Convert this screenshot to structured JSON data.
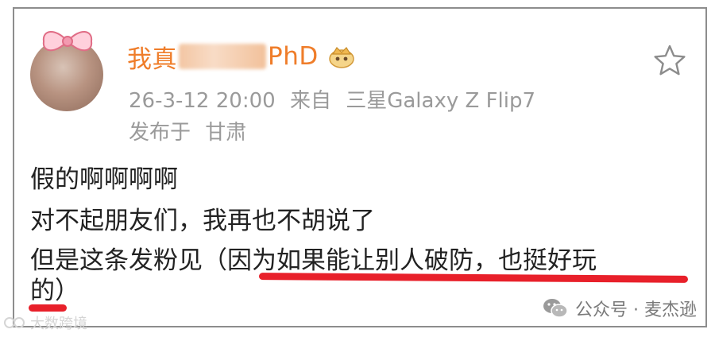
{
  "post": {
    "username_prefix": "我真",
    "username_suffix": "PhD",
    "timestamp": "26-3-12 20:00",
    "source_label": "来自",
    "device": "三星Galaxy Z Flip7",
    "location_label": "发布于",
    "location": "甘肃",
    "content_lines": [
      "假的啊啊啊啊",
      "对不起朋友们，我再也不胡说了",
      "但是这条发粉见（因为如果能让别人破防，也挺好玩",
      "的）"
    ]
  },
  "icons": {
    "badge": "crown-badge-icon",
    "favorite": "star-icon",
    "wechat": "wechat-icon",
    "watermark_left": "watermark-logo-icon"
  },
  "watermarks": {
    "left": "大数跨境",
    "right": "公众号 · 麦杰逊"
  },
  "colors": {
    "username": "#ef7d2a",
    "meta": "#9a9a9a",
    "highlight": "#e8202a",
    "border": "#8d8d8d"
  }
}
